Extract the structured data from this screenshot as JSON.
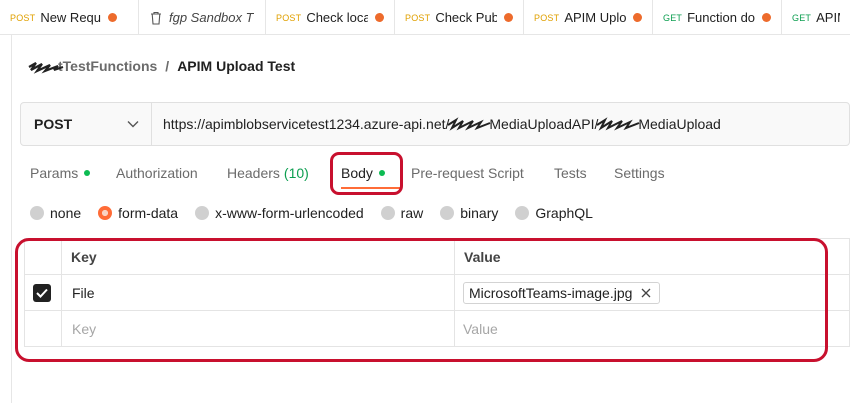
{
  "tabs": [
    {
      "method": "POST",
      "title": "New Requ",
      "unsaved": true
    },
    {
      "method": "",
      "title": "fgp Sandbox T",
      "unsaved": false,
      "icon": "trash-icon"
    },
    {
      "method": "POST",
      "title": "Check loca",
      "unsaved": true
    },
    {
      "method": "POST",
      "title": "Check Pub",
      "unsaved": true
    },
    {
      "method": "POST",
      "title": "APIM Uplo",
      "unsaved": true,
      "active": true
    },
    {
      "method": "GET",
      "title": "Function do",
      "unsaved": true
    },
    {
      "method": "GET",
      "title": "APIM",
      "unsaved": false
    }
  ],
  "breadcrumb": {
    "parent": "tTestFunctions",
    "separator": "/",
    "current": "APIM Upload Test"
  },
  "request": {
    "method": "POST",
    "url_part1": "https://apimblobservicetest1234.azure-api.net/",
    "url_part2": "MediaUploadAPI/",
    "url_part3": "MediaUpload"
  },
  "request_tabs": [
    {
      "label": "Params",
      "dot": true
    },
    {
      "label": "Authorization"
    },
    {
      "label": "Headers",
      "count": "(10)"
    },
    {
      "label": "Body",
      "dot": true,
      "active": true
    },
    {
      "label": "Pre-request Script"
    },
    {
      "label": "Tests"
    },
    {
      "label": "Settings"
    }
  ],
  "body_types": [
    {
      "label": "none"
    },
    {
      "label": "form-data",
      "selected": true
    },
    {
      "label": "x-www-form-urlencoded"
    },
    {
      "label": "raw"
    },
    {
      "label": "binary"
    },
    {
      "label": "GraphQL"
    }
  ],
  "table": {
    "headers": {
      "key": "Key",
      "value": "Value"
    },
    "rows": [
      {
        "checked": true,
        "key": "File",
        "value": "MicrosoftTeams-image.jpg"
      }
    ],
    "placeholder": {
      "key": "Key",
      "value": "Value"
    }
  },
  "colors": {
    "accent": "#ff6c37",
    "annotation_red": "#c8102e",
    "post": "#e0a000",
    "get": "#0c9e50"
  }
}
